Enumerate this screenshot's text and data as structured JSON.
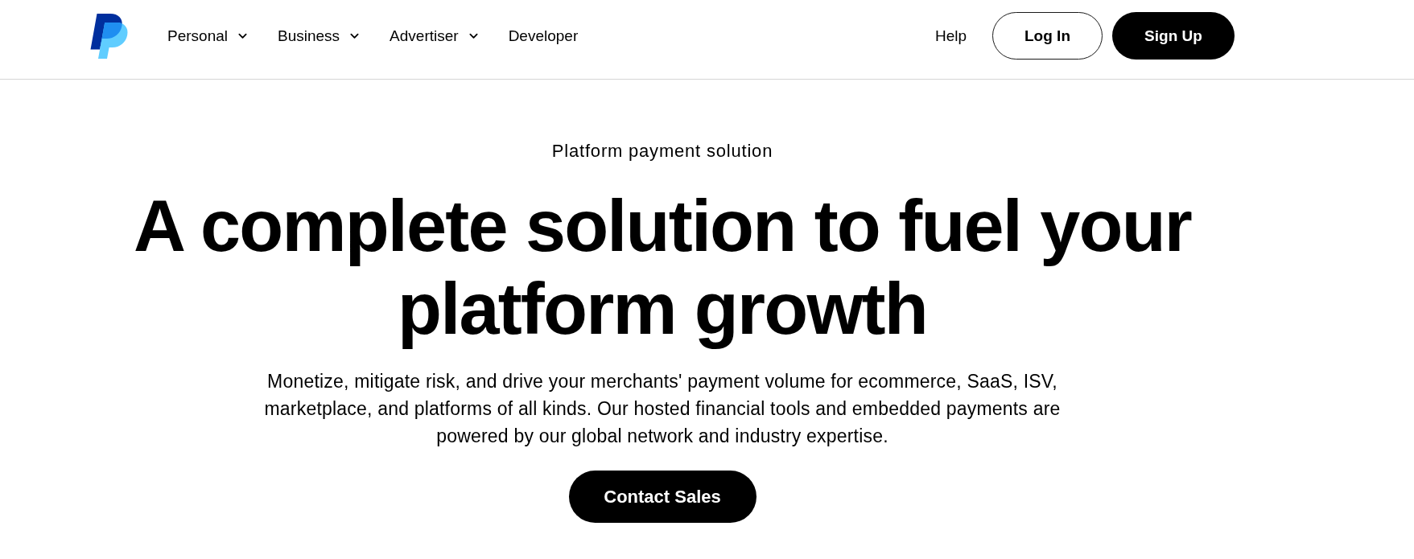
{
  "header": {
    "nav": [
      {
        "label": "Personal",
        "kind": "menu"
      },
      {
        "label": "Business",
        "kind": "menu"
      },
      {
        "label": "Advertiser",
        "kind": "menu"
      },
      {
        "label": "Developer",
        "kind": "link"
      }
    ],
    "help": "Help",
    "login": "Log In",
    "signup": "Sign Up"
  },
  "hero": {
    "eyebrow": "Platform payment solution",
    "title": "A complete solution to fuel your platform growth",
    "description": "Monetize, mitigate risk, and drive your merchants' payment volume for ecommerce, SaaS, ISV, marketplace, and platforms of all kinds. Our hosted financial tools and embedded payments are powered by our global network and industry expertise.",
    "cta": "Contact Sales"
  }
}
